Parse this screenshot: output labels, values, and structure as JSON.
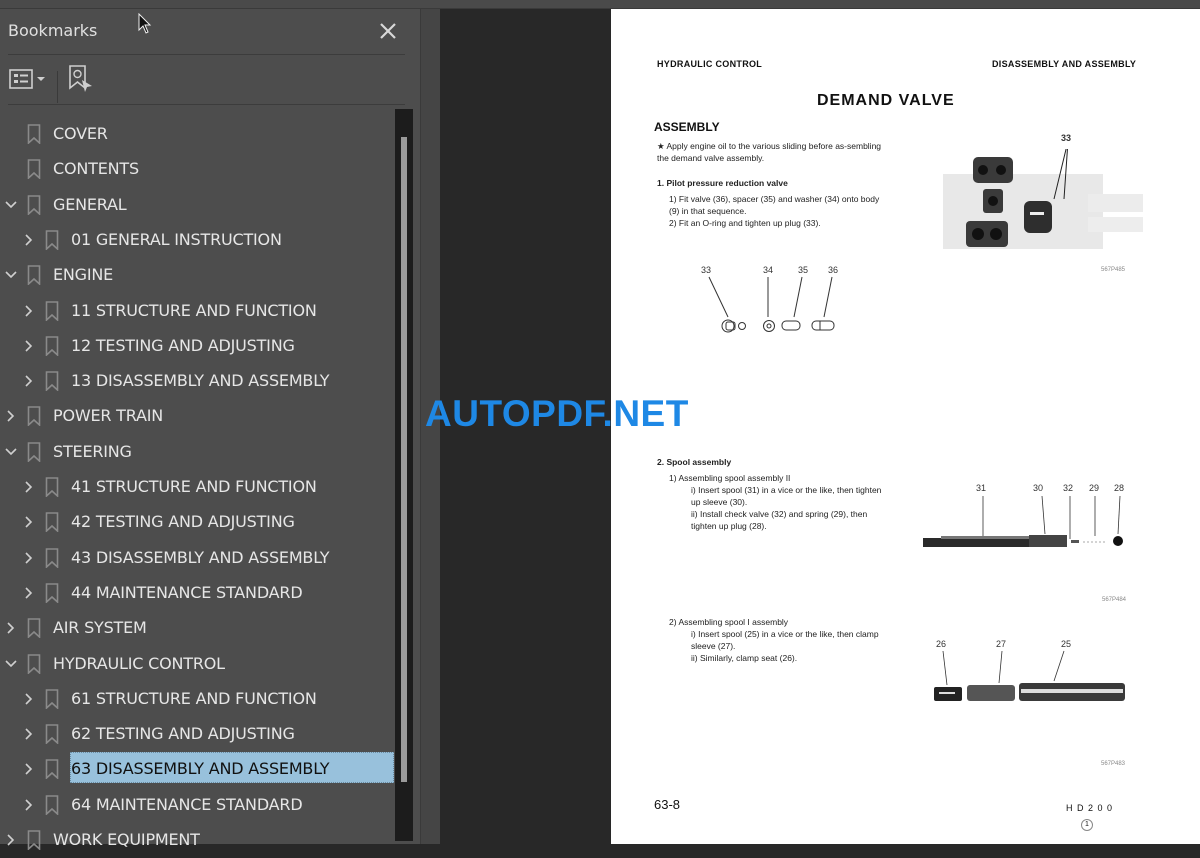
{
  "panel": {
    "title": "Bookmarks",
    "close_icon": "close-icon",
    "options_icon": "bookmark-options-icon",
    "find_icon": "find-current-bookmark-icon"
  },
  "bookmarks": [
    {
      "label": "COVER",
      "level": 0,
      "expander": "none"
    },
    {
      "label": "CONTENTS",
      "level": 0,
      "expander": "none"
    },
    {
      "label": "GENERAL",
      "level": 0,
      "expander": "expanded"
    },
    {
      "label": "01 GENERAL INSTRUCTION",
      "level": 1,
      "expander": "collapsed"
    },
    {
      "label": "ENGINE",
      "level": 0,
      "expander": "expanded"
    },
    {
      "label": "11 STRUCTURE AND FUNCTION",
      "level": 1,
      "expander": "collapsed"
    },
    {
      "label": "12 TESTING AND ADJUSTING",
      "level": 1,
      "expander": "collapsed"
    },
    {
      "label": "13 DISASSEMBLY AND ASSEMBLY",
      "level": 1,
      "expander": "collapsed"
    },
    {
      "label": "POWER TRAIN",
      "level": 0,
      "expander": "collapsed"
    },
    {
      "label": "STEERING",
      "level": 0,
      "expander": "expanded"
    },
    {
      "label": "41 STRUCTURE AND FUNCTION",
      "level": 1,
      "expander": "collapsed"
    },
    {
      "label": "42 TESTING AND ADJUSTING",
      "level": 1,
      "expander": "collapsed"
    },
    {
      "label": "43 DISASSEMBLY AND ASSEMBLY",
      "level": 1,
      "expander": "collapsed"
    },
    {
      "label": "44 MAINTENANCE STANDARD",
      "level": 1,
      "expander": "collapsed"
    },
    {
      "label": "AIR SYSTEM",
      "level": 0,
      "expander": "collapsed"
    },
    {
      "label": "HYDRAULIC CONTROL",
      "level": 0,
      "expander": "expanded"
    },
    {
      "label": "61 STRUCTURE AND FUNCTION",
      "level": 1,
      "expander": "collapsed"
    },
    {
      "label": "62 TESTING AND ADJUSTING",
      "level": 1,
      "expander": "collapsed"
    },
    {
      "label": "63 DISASSEMBLY AND ASSEMBLY",
      "level": 1,
      "expander": "collapsed",
      "selected": true
    },
    {
      "label": "64 MAINTENANCE STANDARD",
      "level": 1,
      "expander": "collapsed"
    },
    {
      "label": "WORK EQUIPMENT",
      "level": 0,
      "expander": "collapsed"
    }
  ],
  "colors": {
    "panel_bg": "#4d4d4d",
    "viewer_bg": "#282828",
    "selection": "#98c1dc",
    "watermark": "#1e88e5"
  },
  "watermark": "AUTOPDF.NET",
  "document": {
    "header_left": "HYDRAULIC CONTROL",
    "header_right": "DISASSEMBLY AND ASSEMBLY",
    "title": "DEMAND VALVE",
    "section": "ASSEMBLY",
    "note": "★  Apply engine oil to the various sliding before as-sembling the demand valve assembly.",
    "step1": {
      "heading": "1.  Pilot pressure reduction valve",
      "items": [
        "1)   Fit valve (36), spacer (35) and washer (34) onto body (9) in that sequence.",
        "2)   Fit an O-ring and tighten up plug (33)."
      ]
    },
    "fig1": {
      "labels": [
        "33",
        "34",
        "35",
        "36"
      ]
    },
    "photo1": {
      "label": "33",
      "code": "567P485"
    },
    "step2": {
      "heading": "2.  Spool assembly",
      "sub1": "1)   Assembling spool assembly II",
      "sub1_items": [
        "i)  Insert spool (31) in a vice or the like, then tighten up sleeve (30).",
        "ii)  Install check valve (32) and spring (29), then tighten up plug (28)."
      ],
      "sub2": "2)   Assembling spool I assembly",
      "sub2_items": [
        "i)  Insert spool (25) in a vice or the like, then clamp sleeve (27).",
        "ii)  Similarly, clamp seat (26)."
      ]
    },
    "photo2": {
      "labels": [
        "31",
        "30",
        "32",
        "29",
        "28"
      ],
      "code": "567P484"
    },
    "photo3": {
      "labels": [
        "26",
        "27",
        "25"
      ],
      "code": "567P483"
    },
    "page_number": "63-8",
    "model": "H D 2 0 0",
    "revision": "1"
  }
}
